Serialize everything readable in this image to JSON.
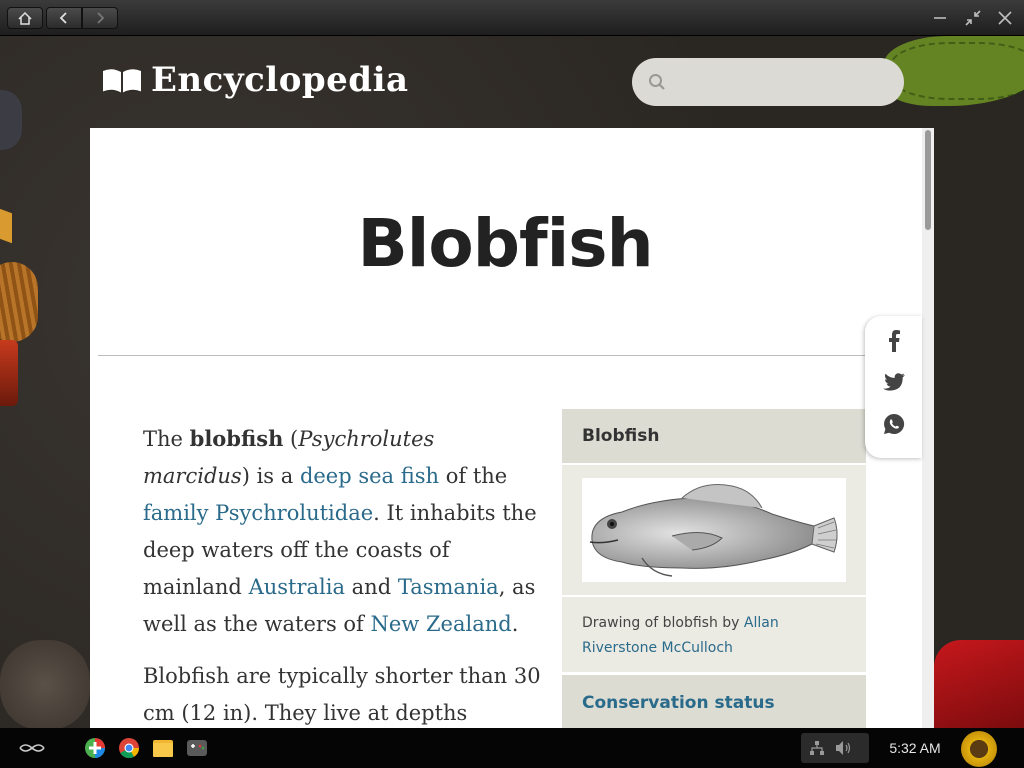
{
  "window": {
    "controls": [
      "home",
      "back",
      "forward",
      "minimize",
      "restore",
      "close"
    ]
  },
  "app": {
    "brand": "Encyclopedia",
    "search_placeholder": ""
  },
  "article": {
    "title": "Blobfish",
    "p1": {
      "t1": "The ",
      "b1": "blobfish",
      "t2": " (",
      "i1": "Psychrolutes marcidus",
      "t3": ") is a ",
      "l1": "deep sea fish",
      "t4": " of the ",
      "l2": "family Psychrolutidae",
      "t5": ". It inhabits the deep waters off the coasts of mainland ",
      "l3": "Australia",
      "t6": " and ",
      "l4": "Tasmania",
      "t7": ", as well as the waters of ",
      "l5": "New Zealand",
      "t8": "."
    },
    "p2": "Blobfish are typically shorter than 30 cm (12 in). They live at depths"
  },
  "infobox": {
    "header": "Blobfish",
    "image_alt": "blobfish drawing",
    "caption_prefix": "Drawing of blobfish by ",
    "caption_link": "Allan Riverstone McCulloch",
    "conservation": "Conservation status"
  },
  "share": [
    "facebook",
    "twitter",
    "whatsapp"
  ],
  "taskbar": {
    "clock": "5:32 AM",
    "apps": [
      "launcher",
      "add-app",
      "chrome",
      "files",
      "encyclopedia"
    ]
  }
}
